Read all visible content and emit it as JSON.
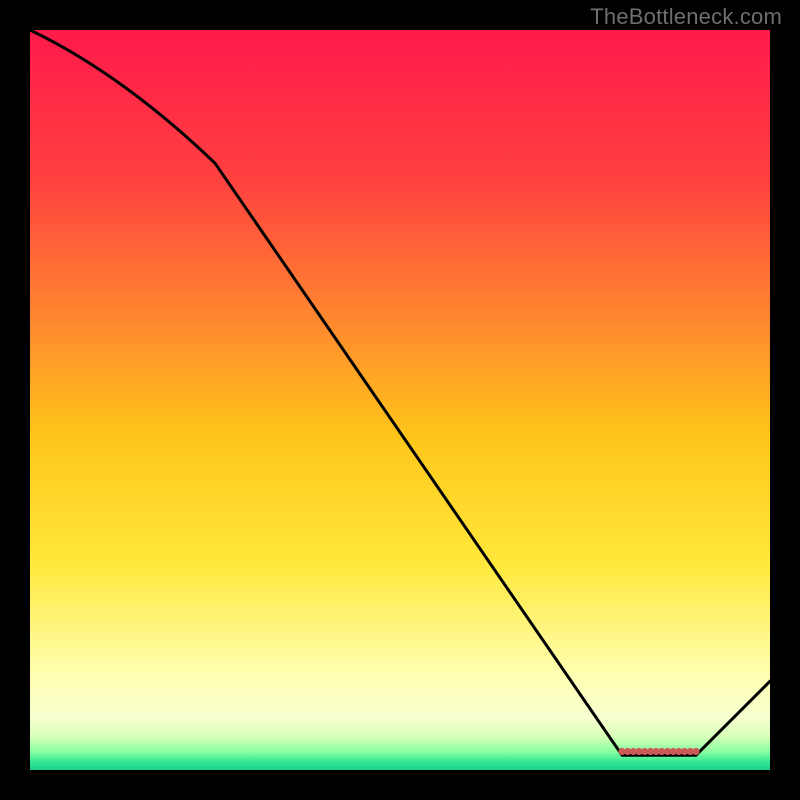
{
  "watermark": "TheBottleneck.com",
  "chart_data": {
    "type": "line",
    "title": "",
    "xlabel": "",
    "ylabel": "",
    "xlim": [
      0,
      100
    ],
    "ylim": [
      0,
      100
    ],
    "grid": false,
    "legend": false,
    "x": [
      0,
      25,
      80,
      90,
      100
    ],
    "values": [
      100,
      82,
      2,
      2,
      12
    ],
    "gradient_stops": [
      {
        "offset": 0.0,
        "color": "#ff1a4b"
      },
      {
        "offset": 0.2,
        "color": "#ff4040"
      },
      {
        "offset": 0.4,
        "color": "#ff8b2e"
      },
      {
        "offset": 0.55,
        "color": "#ffc61a"
      },
      {
        "offset": 0.72,
        "color": "#ffe83a"
      },
      {
        "offset": 0.87,
        "color": "#ffffb0"
      },
      {
        "offset": 0.93,
        "color": "#f7ffd0"
      },
      {
        "offset": 0.955,
        "color": "#d6ffb8"
      },
      {
        "offset": 0.975,
        "color": "#8affa0"
      },
      {
        "offset": 0.99,
        "color": "#30e594"
      },
      {
        "offset": 1.0,
        "color": "#1fd08a"
      }
    ],
    "dots": {
      "color": "#cc5a57",
      "y": 2.5,
      "x_start": 80,
      "x_end": 90,
      "count": 14
    },
    "line_color": "#000000"
  }
}
